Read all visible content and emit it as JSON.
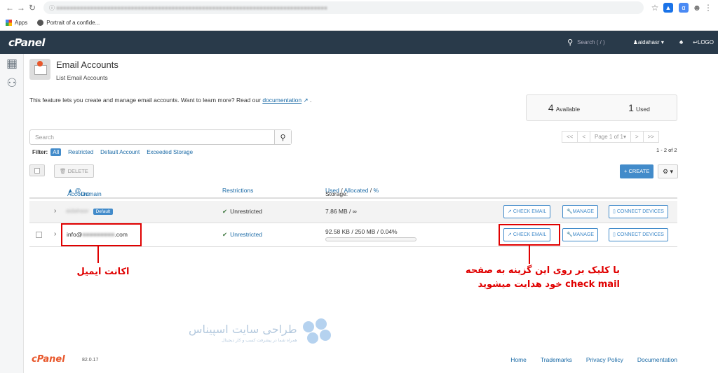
{
  "browser": {
    "bookmarks": [
      "Apps",
      "Portrait of a confide..."
    ]
  },
  "cpanel": {
    "logo": "cPanel",
    "search_placeholder": "Search ( / )",
    "username": "aidahasr",
    "logout_label": "LOGO"
  },
  "page": {
    "title": "Email Accounts",
    "subtitle": "List Email Accounts",
    "description": "This feature lets you create and manage email accounts. Want to learn more? Read our",
    "doc_link": "documentation",
    "available_count": "4",
    "available_label": "Available",
    "used_count": "1",
    "used_label": "Used"
  },
  "search": {
    "placeholder": "Search"
  },
  "pagination": {
    "first": "<<",
    "prev": "<",
    "page": "Page 1 of 1",
    "next": ">",
    "last": ">>",
    "count": "1 - 2 of 2"
  },
  "filter": {
    "label": "Filter:",
    "options": [
      "All",
      "Restricted",
      "Default Account",
      "Exceeded Storage"
    ]
  },
  "toolbar": {
    "delete_label": "DELETE",
    "create_label": "+ CREATE"
  },
  "table": {
    "headers": {
      "account": "Account",
      "domain": "Domain",
      "restrictions": "Restrictions",
      "storage_prefix": "Storage:",
      "storage_used": "Used",
      "storage_allocated": "Allocated",
      "storage_percent": "%"
    },
    "rows": [
      {
        "account": "aidahasr",
        "badge": "Default",
        "restriction": "Unrestricted",
        "storage": "7.86 MB / ∞",
        "usage_fraction": null
      },
      {
        "account": "info@",
        "account_suffix": ".com",
        "restriction": "Unrestricted",
        "storage": "92.58 KB / 250 MB / 0.04%",
        "usage_fraction": 0.0004
      }
    ],
    "actions": {
      "check_email": "CHECK EMAIL",
      "manage": "MANAGE",
      "connect_devices": "CONNECT DEVICES"
    }
  },
  "annotations": {
    "email_account_label": "اکانت ایمیل",
    "check_email_line1": "با کلیک بر روی این گزینه به صفحه",
    "check_email_line2": "check mail خود هدایت میشوید"
  },
  "watermark": {
    "title": "طراحی سایت اسپیناس",
    "subtitle": "همراه شما در پیشرفت کسب و کار دیجیتال"
  },
  "footer": {
    "logo": "cPanel",
    "version": "82.0.17",
    "links": [
      "Home",
      "Trademarks",
      "Privacy Policy",
      "Documentation"
    ]
  },
  "colors": {
    "topbar": "#293a4a",
    "accent": "#428bca",
    "annotation": "#e00000",
    "brand_orange": "#e8572b"
  }
}
